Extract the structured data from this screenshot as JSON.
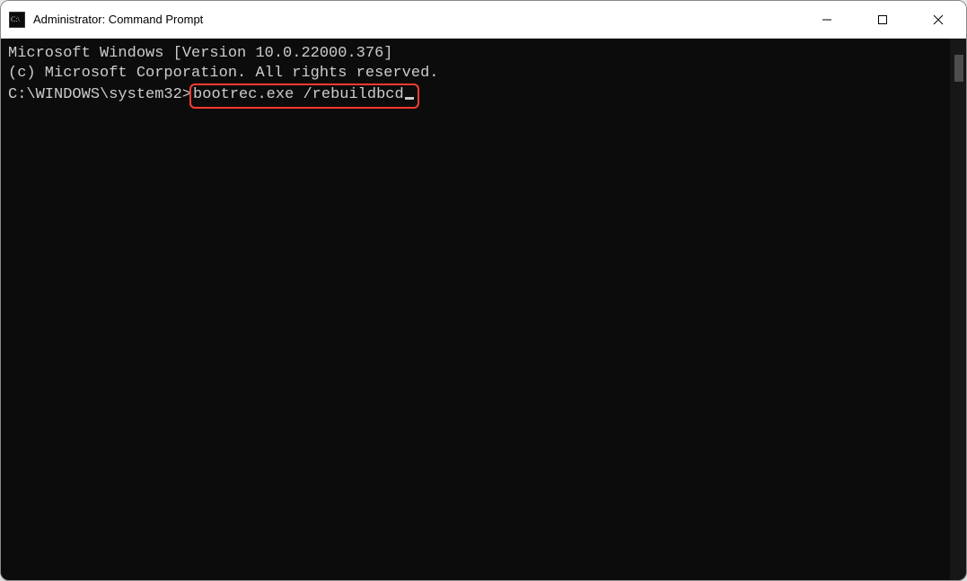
{
  "window": {
    "title": "Administrator: Command Prompt"
  },
  "terminal": {
    "line1": "Microsoft Windows [Version 10.0.22000.376]",
    "line2": "(c) Microsoft Corporation. All rights reserved.",
    "blank": "",
    "prompt": "C:\\WINDOWS\\system32>",
    "command": "bootrec.exe /rebuildbcd"
  }
}
